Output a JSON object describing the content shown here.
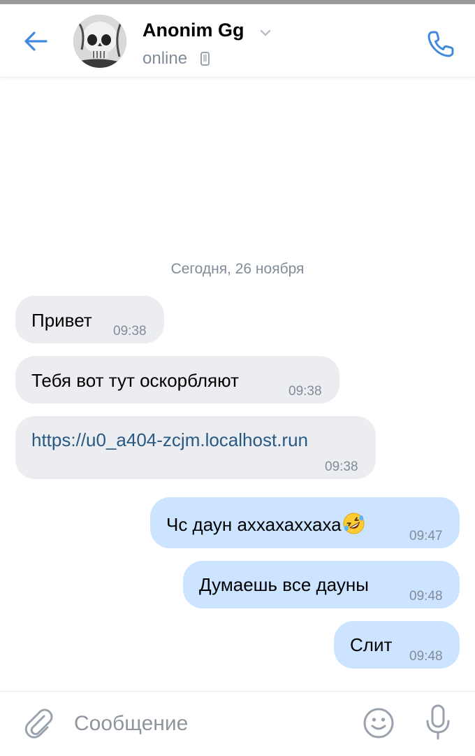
{
  "header": {
    "back_icon": "arrow-left-icon",
    "contact_name": "Anonim Gg",
    "status": "online",
    "status_icon": "mobile-phone-icon",
    "call_icon": "phone-icon",
    "accent_color": "#3f8ae0"
  },
  "chat": {
    "date_separator": "Сегодня, 26 ноября",
    "messages": [
      {
        "direction": "incoming",
        "text": "Привет",
        "time": "09:38"
      },
      {
        "direction": "incoming",
        "text": "Тебя вот тут оскорбляют",
        "time": "09:38"
      },
      {
        "direction": "incoming",
        "text": "https://u0_a404-zcjm.localhost.run",
        "time": "09:38",
        "is_link": true
      },
      {
        "direction": "outgoing",
        "text": "Чс даун аххахаххаха",
        "emoji": "rolling-on-floor-laughing",
        "time": "09:47"
      },
      {
        "direction": "outgoing",
        "text": "Думаешь все дауны",
        "time": "09:48"
      },
      {
        "direction": "outgoing",
        "text": "Слит",
        "time": "09:48"
      }
    ],
    "incoming_bubble_color": "#ebedf0",
    "outgoing_bubble_color": "#cce4ff",
    "link_color": "#2a5885"
  },
  "composer": {
    "placeholder": "Сообщение",
    "value": "",
    "attach_icon": "paperclip-icon",
    "emoji_icon": "smiley-icon",
    "mic_icon": "microphone-icon"
  }
}
